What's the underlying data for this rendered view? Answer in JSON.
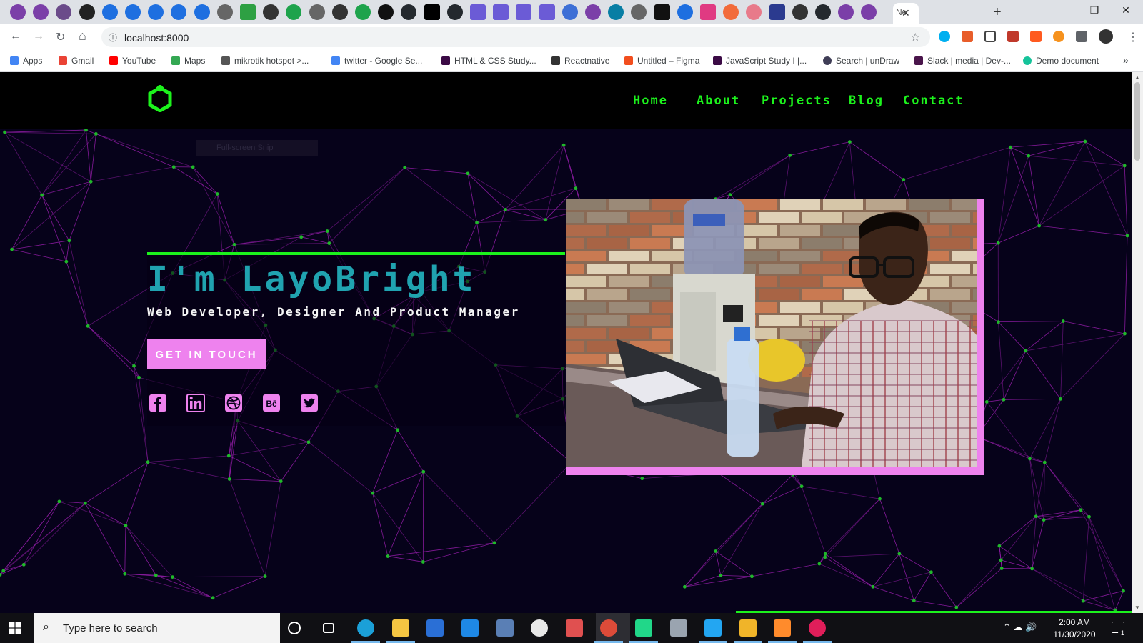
{
  "browser": {
    "active_tab": {
      "title": "Ne",
      "close_glyph": "✕"
    },
    "new_tab_glyph": "+",
    "window_controls": [
      "—",
      "❐",
      "✕"
    ],
    "tab_icons": [
      "opera-icon",
      "opera-icon",
      "pen-icon",
      "cube-icon",
      "c-icon",
      "c-icon",
      "c-icon",
      "c-icon",
      "c-icon",
      "globe-icon",
      "gallery-icon",
      "h-icon",
      "seven-icon",
      "globe-icon",
      "diamond-icon",
      "seven-icon",
      "terminal-icon",
      "github-icon",
      "medium-icon",
      "github-icon",
      "flag-icon",
      "flag-icon",
      "flag-icon",
      "flag-icon",
      "shield-icon",
      "opera-icon",
      "react-icon",
      "globe-icon",
      "square-icon",
      "c-icon",
      "box-icon",
      "link-icon",
      "puzzle-icon",
      "chart-icon",
      "diamond-icon",
      "github-icon",
      "opera-icon",
      "opera-icon"
    ],
    "address": {
      "url": "localhost:8000",
      "info_glyph": "ⓘ"
    },
    "nav_glyphs": {
      "back": "←",
      "forward": "→",
      "reload": "↻",
      "home": "⌂",
      "star": "☆",
      "menu": "⋮"
    },
    "bookmarks": [
      {
        "label": "Apps",
        "color": "#4285f4"
      },
      {
        "label": "Gmail",
        "color": "#ea4335"
      },
      {
        "label": "YouTube",
        "color": "#ff0000"
      },
      {
        "label": "Maps",
        "color": "#34a853"
      },
      {
        "label": "mikrotik hotspot >...",
        "color": "#555555"
      },
      {
        "label": "twitter - Google Se...",
        "color": "#4285f4"
      },
      {
        "label": "HTML & CSS Study...",
        "color": "#3b0a45"
      },
      {
        "label": "Reactnative",
        "color": "#333333"
      },
      {
        "label": "Untitled – Figma",
        "color": "#f24e1e"
      },
      {
        "label": "JavaScript Study I |...",
        "color": "#3b0a45"
      },
      {
        "label": "Search | unDraw",
        "color": "#3f3d56"
      },
      {
        "label": "Slack | media | Dev-...",
        "color": "#4a154b"
      },
      {
        "label": "Demo document",
        "color": "#15c39a"
      }
    ],
    "bookmarks_overflow": "»"
  },
  "site": {
    "nav": [
      "Home",
      "About",
      "Projects",
      "Blog",
      "Contact"
    ],
    "accent": "#1cf21c",
    "pink": "#ee82ee",
    "hero": {
      "title": "I'm LayoBright",
      "subtitle": "Web Developer, Designer And Product Manager",
      "cta": "GET IN TOUCH"
    },
    "socials": [
      "facebook-icon",
      "linkedin-icon",
      "dribbble-icon",
      "behance-icon",
      "twitter-icon"
    ],
    "ghost_overlay": "Full-screen Snip"
  },
  "taskbar": {
    "search_placeholder": "Type here to search",
    "time": "2:00 AM",
    "date": "11/30/2020",
    "notification_count": "1",
    "apps": [
      "cortana-icon",
      "task-view-icon",
      "edge-icon",
      "file-explorer-icon",
      "store-icon",
      "mail-icon",
      "remote-desktop-icon",
      "onedrive-icon",
      "paint-icon",
      "chrome-icon",
      "jetbrains-icon",
      "settings-icon",
      "vscode-icon",
      "git-icon",
      "sublime-icon",
      "slack-icon"
    ]
  }
}
